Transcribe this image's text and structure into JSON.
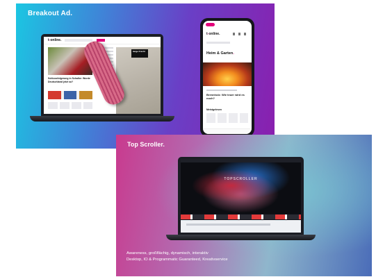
{
  "card_breakout": {
    "title": "Breakout Ad.",
    "laptop": {
      "logo": "t",
      "logo_rest": "online.",
      "headline": "Schlussfolgerung in Schalke: Wurde Deutschland jetzt so?",
      "badge": "lange Fracht"
    },
    "phone": {
      "logo": "t",
      "logo_rest": "online.",
      "heading": "Heim & Garten",
      "heading_dot": ".",
      "article": "Brennholz: Wie teuer wird es noch?",
      "section": "Meistgelesen"
    }
  },
  "card_topscroller": {
    "title": "Top Scroller.",
    "screen_label": "TOPSCROLLER",
    "desc_line1": "Awareness, großflächig, dynamisch, interaktiv",
    "desc_line2": "Desktop, IO & Programmatic Guaranteed, Kreativservice"
  },
  "colors": {
    "brand_pink": "#e2007a",
    "card1_from": "#1bc6e2",
    "card1_to": "#8a1fae",
    "card2_from": "#c93a8e",
    "card2_to": "#4a6cb8"
  }
}
